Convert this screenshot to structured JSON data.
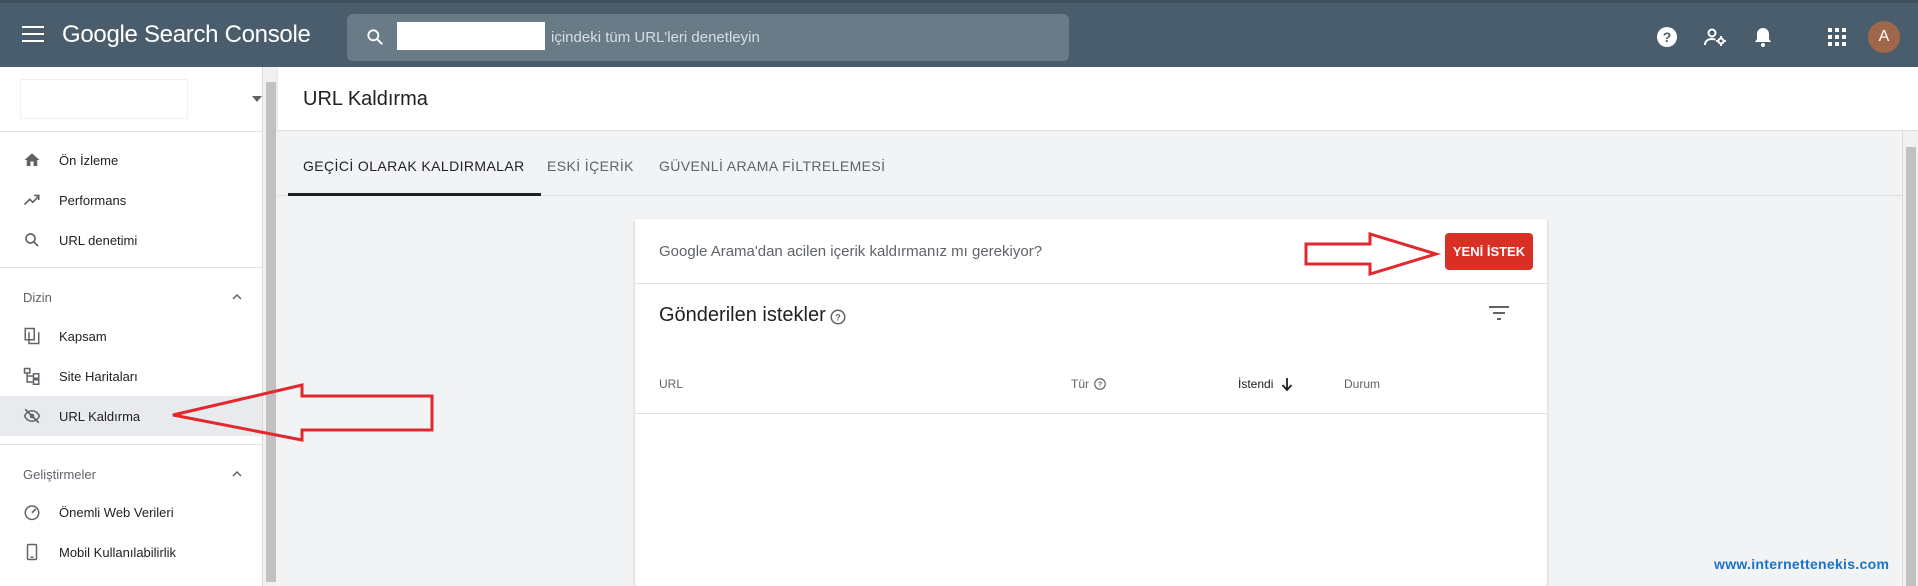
{
  "app": {
    "logo_google": "Google",
    "logo_product": "Search Console"
  },
  "search": {
    "placeholder": "içindeki tüm URL'leri denetleyin"
  },
  "user": {
    "avatar_letter": "A",
    "avatar_color": "#a0674b"
  },
  "sidebar": {
    "items_top": [
      {
        "label": "Ön İzleme",
        "icon": "home-icon"
      },
      {
        "label": "Performans",
        "icon": "trending-up-icon"
      },
      {
        "label": "URL denetimi",
        "icon": "search-icon"
      }
    ],
    "section_index": {
      "label": "Dizin"
    },
    "items_index": [
      {
        "label": "Kapsam",
        "icon": "pages-icon"
      },
      {
        "label": "Site Haritaları",
        "icon": "sitemap-icon"
      },
      {
        "label": "URL Kaldırma",
        "icon": "eye-off-icon",
        "active": true
      }
    ],
    "section_enh": {
      "label": "Geliştirmeler"
    },
    "items_enh": [
      {
        "label": "Önemli Web Verileri",
        "icon": "gauge-icon"
      },
      {
        "label": "Mobil Kullanılabilirlik",
        "icon": "phone-icon"
      }
    ]
  },
  "page": {
    "title": "URL Kaldırma"
  },
  "tabs": [
    {
      "label": "GEÇİCİ OLARAK KALDIRMALAR",
      "active": true
    },
    {
      "label": "ESKİ İÇERİK",
      "active": false
    },
    {
      "label": "GÜVENLİ ARAMA FİLTRELEMESİ",
      "active": false
    }
  ],
  "card": {
    "question": "Google Arama'dan acilen içerik kaldırmanız mı gerekiyor?",
    "new_request_label": "YENİ İSTEK",
    "submitted_title": "Gönderilen istekler",
    "columns": {
      "url": "URL",
      "type": "Tür",
      "requested": "İstendi",
      "status": "Durum"
    }
  },
  "watermark": "www.internettenekis.com",
  "colors": {
    "topbar": "#4a5d6c",
    "accent_red": "#d93025",
    "annotation_arrow": "#e0282e"
  }
}
